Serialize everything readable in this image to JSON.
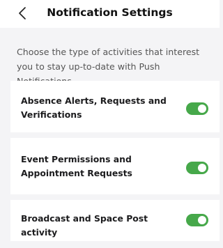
{
  "header": {
    "title": "Notification Settings",
    "back_icon": "chevron-left-icon"
  },
  "intro": {
    "text": "Choose the type of activities that interest you to stay up-to-date with Push Notifications."
  },
  "settings": [
    {
      "label": "Absence Alerts, Requests and Verifications",
      "enabled": true
    },
    {
      "label": "Event Permissions and Appointment Requests",
      "enabled": true
    },
    {
      "label": "Broadcast and Space Post activity",
      "enabled": true
    }
  ],
  "colors": {
    "toggle_on": "#46a84a",
    "background": "#f4f4f6",
    "card": "#ffffff"
  }
}
